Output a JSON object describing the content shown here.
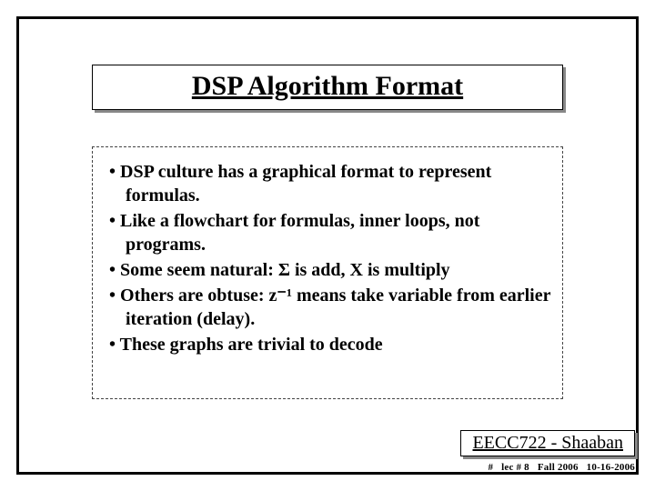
{
  "title": "DSP Algorithm Format",
  "bullets": [
    "DSP culture has a graphical format to represent formulas.",
    "Like a flowchart for formulas, inner loops, not programs.",
    "Some seem natural: Σ  is add, X is multiply",
    "Others are obtuse: z⁻¹ means take variable from earlier iteration (delay).",
    "These graphs are trivial to decode"
  ],
  "course": "EECC722 - Shaaban",
  "footer": {
    "slide_no": "#",
    "lec": "lec # 8",
    "term": "Fall 2006",
    "date": "10-16-2006"
  }
}
